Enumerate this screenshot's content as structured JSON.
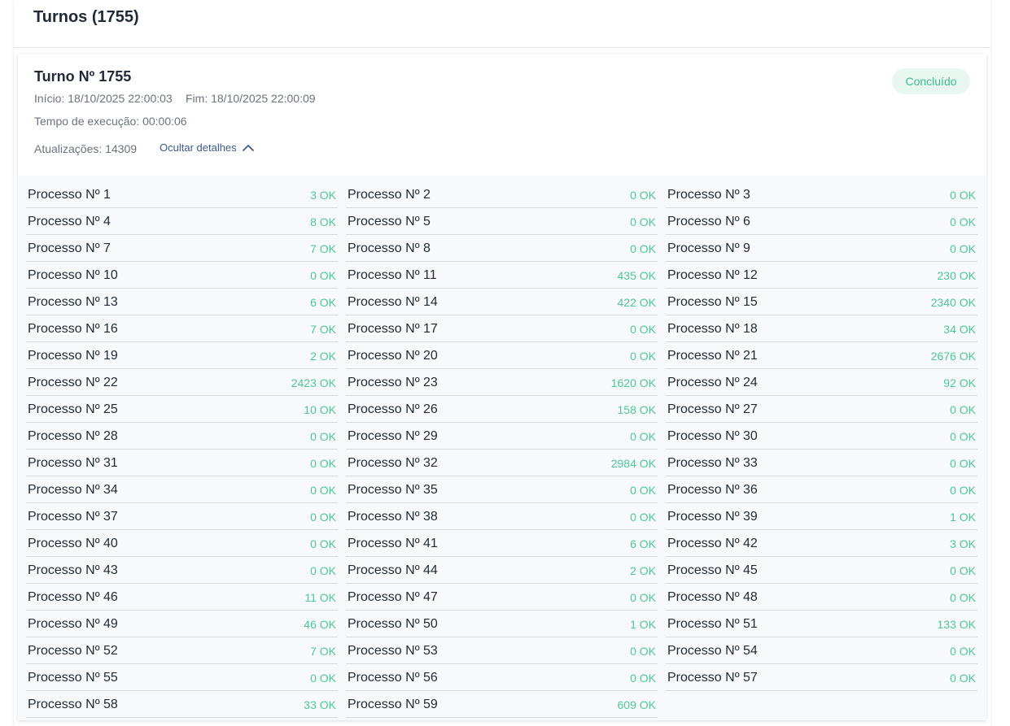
{
  "header": {
    "title": "Turnos (1755)"
  },
  "turno": {
    "title": "Turno Nº 1755",
    "inicio": "Início: 18/10/2025 22:00:03",
    "fim": "Fim: 18/10/2025 22:00:09",
    "tempo": "Tempo de execução: 00:00:06",
    "atualizacoes": "Atualizações: 14309",
    "toggle_label": "Ocultar detalhes",
    "toggle_icon": "chevron-up-icon",
    "status": "Concluído"
  },
  "colors": {
    "ok_green": "#4cc79a",
    "badge_bg": "#e9f7f1",
    "badge_text": "#3dba8f",
    "link": "#3b5b8c"
  },
  "processes": [
    {
      "name": "Processo Nº 1",
      "value": "3 OK"
    },
    {
      "name": "Processo Nº 2",
      "value": "0 OK"
    },
    {
      "name": "Processo Nº 3",
      "value": "0 OK"
    },
    {
      "name": "Processo Nº 4",
      "value": "8 OK"
    },
    {
      "name": "Processo Nº 5",
      "value": "0 OK"
    },
    {
      "name": "Processo Nº 6",
      "value": "0 OK"
    },
    {
      "name": "Processo Nº 7",
      "value": "7 OK"
    },
    {
      "name": "Processo Nº 8",
      "value": "0 OK"
    },
    {
      "name": "Processo Nº 9",
      "value": "0 OK"
    },
    {
      "name": "Processo Nº 10",
      "value": "0 OK"
    },
    {
      "name": "Processo Nº 11",
      "value": "435 OK"
    },
    {
      "name": "Processo Nº 12",
      "value": "230 OK"
    },
    {
      "name": "Processo Nº 13",
      "value": "6 OK"
    },
    {
      "name": "Processo Nº 14",
      "value": "422 OK"
    },
    {
      "name": "Processo Nº 15",
      "value": "2340 OK"
    },
    {
      "name": "Processo Nº 16",
      "value": "7 OK"
    },
    {
      "name": "Processo Nº 17",
      "value": "0 OK"
    },
    {
      "name": "Processo Nº 18",
      "value": "34 OK"
    },
    {
      "name": "Processo Nº 19",
      "value": "2 OK"
    },
    {
      "name": "Processo Nº 20",
      "value": "0 OK"
    },
    {
      "name": "Processo Nº 21",
      "value": "2676 OK"
    },
    {
      "name": "Processo Nº 22",
      "value": "2423 OK"
    },
    {
      "name": "Processo Nº 23",
      "value": "1620 OK"
    },
    {
      "name": "Processo Nº 24",
      "value": "92 OK"
    },
    {
      "name": "Processo Nº 25",
      "value": "10 OK"
    },
    {
      "name": "Processo Nº 26",
      "value": "158 OK"
    },
    {
      "name": "Processo Nº 27",
      "value": "0 OK"
    },
    {
      "name": "Processo Nº 28",
      "value": "0 OK"
    },
    {
      "name": "Processo Nº 29",
      "value": "0 OK"
    },
    {
      "name": "Processo Nº 30",
      "value": "0 OK"
    },
    {
      "name": "Processo Nº 31",
      "value": "0 OK"
    },
    {
      "name": "Processo Nº 32",
      "value": "2984 OK"
    },
    {
      "name": "Processo Nº 33",
      "value": "0 OK"
    },
    {
      "name": "Processo Nº 34",
      "value": "0 OK"
    },
    {
      "name": "Processo Nº 35",
      "value": "0 OK"
    },
    {
      "name": "Processo Nº 36",
      "value": "0 OK"
    },
    {
      "name": "Processo Nº 37",
      "value": "0 OK"
    },
    {
      "name": "Processo Nº 38",
      "value": "0 OK"
    },
    {
      "name": "Processo Nº 39",
      "value": "1 OK"
    },
    {
      "name": "Processo Nº 40",
      "value": "0 OK"
    },
    {
      "name": "Processo Nº 41",
      "value": "6 OK"
    },
    {
      "name": "Processo Nº 42",
      "value": "3 OK"
    },
    {
      "name": "Processo Nº 43",
      "value": "0 OK"
    },
    {
      "name": "Processo Nº 44",
      "value": "2 OK"
    },
    {
      "name": "Processo Nº 45",
      "value": "0 OK"
    },
    {
      "name": "Processo Nº 46",
      "value": "11 OK"
    },
    {
      "name": "Processo Nº 47",
      "value": "0 OK"
    },
    {
      "name": "Processo Nº 48",
      "value": "0 OK"
    },
    {
      "name": "Processo Nº 49",
      "value": "46 OK"
    },
    {
      "name": "Processo Nº 50",
      "value": "1 OK"
    },
    {
      "name": "Processo Nº 51",
      "value": "133 OK"
    },
    {
      "name": "Processo Nº 52",
      "value": "7 OK"
    },
    {
      "name": "Processo Nº 53",
      "value": "0 OK"
    },
    {
      "name": "Processo Nº 54",
      "value": "0 OK"
    },
    {
      "name": "Processo Nº 55",
      "value": "0 OK"
    },
    {
      "name": "Processo Nº 56",
      "value": "0 OK"
    },
    {
      "name": "Processo Nº 57",
      "value": "0 OK"
    },
    {
      "name": "Processo Nº 58",
      "value": "33 OK"
    },
    {
      "name": "Processo Nº 59",
      "value": "609 OK"
    }
  ]
}
